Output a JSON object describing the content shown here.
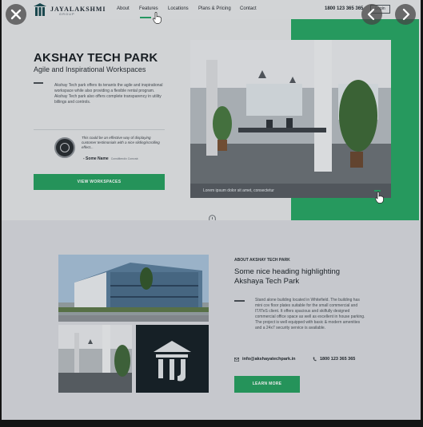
{
  "nav": {
    "brand": "JAYALAKSHMI",
    "brand_sub": "GROUP",
    "items": [
      "About",
      "Features",
      "Locations",
      "Plans & Pricing",
      "Contact"
    ],
    "phone": "1800 123 365 365",
    "login_label": "Login"
  },
  "hero": {
    "title": "AKSHAY TECH PARK",
    "subtitle": "Agile and Inspirational Workspaces",
    "description": "Akshay Tech park offers its tenants the agile and inspirational workspace while also providing a flexible rental program. Akshay Tech park also offers complete transparency in utility billings and controls.",
    "testimonial_text": "This could be an effective way of displaying customer testimonials with a nice sliding/scrolling effect...",
    "testimonial_name": "- Some Name",
    "testimonial_role": "Constiltendix Comcstr.",
    "cta_label": "VIEW WORKSPACES",
    "photo_caption": "Lorem ipsum dolor sit amet, consectetur"
  },
  "about": {
    "kicker": "ABOUT AKSHAY TECH PARK",
    "heading": "Some nice heading highlighting Akshaya Tech Park",
    "description": "Stand alone building located in Whitefield. The building has mini cov floor plates suitable for the small commercial and IT/ITeS client. It offers spacious and skilfully designed commercial office space as well as excellent in house parking. The project is well equipped with basic & modern amenities and a 24x7 security service is available.",
    "email": "info@akshayatechpark.in",
    "phone": "1800 123 365 365",
    "cta_label": "LEARN MORE"
  },
  "viewer": {
    "close_icon": "close-icon",
    "prev_icon": "chevron-left-icon",
    "next_icon": "chevron-right-icon"
  },
  "colors": {
    "accent": "#2aa766",
    "dark": "#1b2127",
    "background": "#dcdfe3"
  }
}
